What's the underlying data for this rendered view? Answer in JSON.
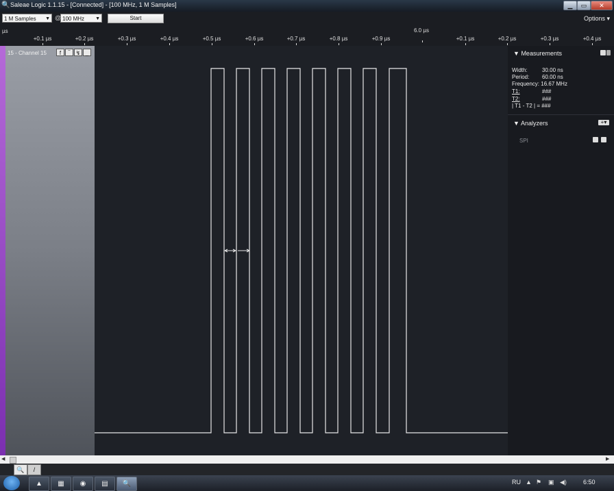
{
  "window": {
    "title": "Saleae Logic 1.1.15 - [Connected] - [100 MHz, 1 M Samples]",
    "controls": {
      "minimize": "▁",
      "maximize": "▭",
      "close": "✕"
    }
  },
  "toolbar": {
    "samples_value": "1 M Samples",
    "at_label": "@",
    "rate_value": "100 MHz",
    "start_label": "Start",
    "options_label": "Options ▾"
  },
  "ruler": {
    "unit_label": "µs",
    "center_label": "6.0 µs",
    "ticks": [
      "+0.1 µs",
      "+0.2 µs",
      "+0.3 µs",
      "+0.4 µs",
      "+0.5 µs",
      "+0.6 µs",
      "+0.7 µs",
      "+0.8 µs",
      "+0.9 µs",
      "+0.1 µs",
      "+0.2 µs",
      "+0.3 µs",
      "+0.4 µs"
    ]
  },
  "channel": {
    "name": "15 - Channel 15",
    "color": "#9b4fd0",
    "trigger_buttons": [
      "f",
      "‾",
      "↯",
      "_"
    ]
  },
  "waveform": {
    "line_color": "#e8e8e8",
    "pulse_count": 8,
    "cursor_markers": true
  },
  "measurements": {
    "header": "Measurements",
    "width_label": "Width:",
    "width_value": "30.00 ns",
    "period_label": "Period:",
    "period_value": "60.00 ns",
    "frequency_label": "Frequency:",
    "frequency_value": "16.67 MHz",
    "t1_label": "T1:",
    "t1_value": "###",
    "t2_label": "T2:",
    "t2_value": "###",
    "diff_label": "| T1 - T2 | =",
    "diff_value": "###"
  },
  "analyzers": {
    "header": "Analyzers",
    "add_label": "+▾",
    "items": [
      "SPI"
    ]
  },
  "taskbar": {
    "language": "RU",
    "clock": "6:50"
  }
}
